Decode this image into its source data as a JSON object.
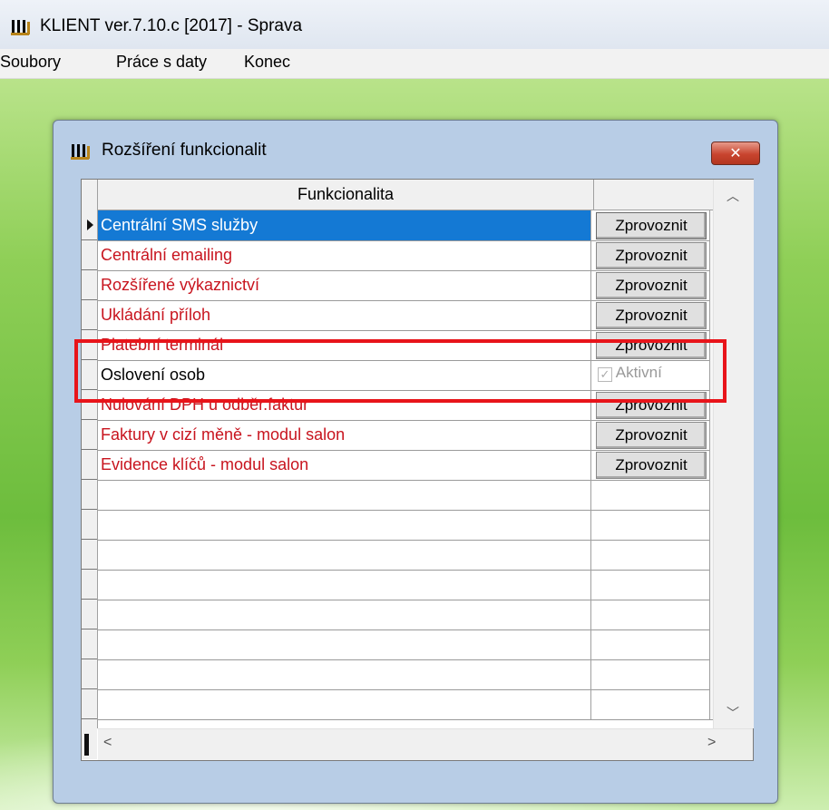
{
  "app": {
    "title": "KLIENT ver.7.10.c [2017] - Sprava",
    "menu": [
      "Soubory",
      "Práce s daty",
      "Konec"
    ]
  },
  "dialog": {
    "title": "Rozšíření funkcionalit",
    "close_label": "✕",
    "columns": {
      "function": "Funkcionalita",
      "action": ""
    },
    "rows": [
      {
        "name": "Centrální SMS služby",
        "action": "Zprovoznit",
        "selected": true,
        "color": "#ffffff"
      },
      {
        "name": "Centrální emailing",
        "action": "Zprovoznit",
        "color": "#c8141e"
      },
      {
        "name": "Rozšířené výkaznictví",
        "action": "Zprovoznit",
        "color": "#c8141e"
      },
      {
        "name": "Ukládání příloh",
        "action": "Zprovoznit",
        "color": "#c8141e"
      },
      {
        "name": "Platební terminál",
        "action": "Zprovoznit",
        "color": "#c8141e"
      },
      {
        "name": "Oslovení osob",
        "action": "Aktivní",
        "active": true,
        "color": "#000000"
      },
      {
        "name": "Nulování DPH u odběr.faktur",
        "action": "Zprovoznit",
        "color": "#c8141e"
      },
      {
        "name": "Faktury v cizí měně - modul salon",
        "action": "Zprovoznit",
        "color": "#c8141e"
      },
      {
        "name": "Evidence klíčů - modul salon",
        "action": "Zprovoznit",
        "color": "#c8141e"
      }
    ],
    "empty_rows": 8
  },
  "colors": {
    "accent": "#1479d4",
    "highlight": "#e8141a",
    "inactive_text": "#c8141e"
  }
}
